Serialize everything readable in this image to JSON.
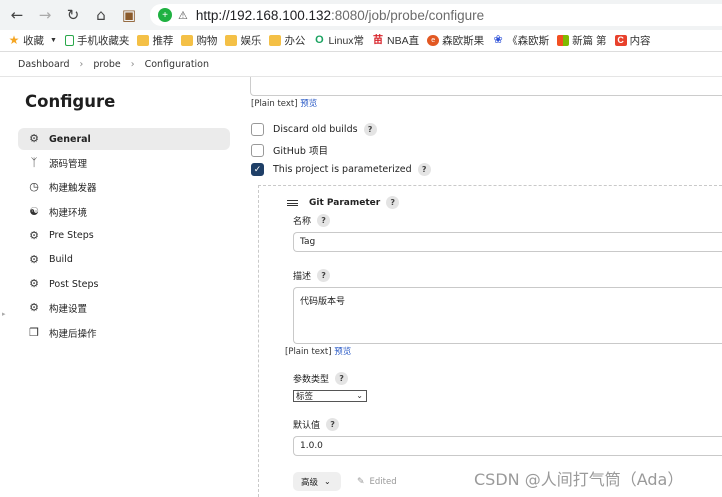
{
  "browser": {
    "url_host": "http://192.168.100.132",
    "url_path": ":8080/job/probe/configure",
    "bookmarks": [
      {
        "label": "收藏",
        "icon": "star-icon",
        "color": "#f5a623"
      },
      {
        "label": "手机收藏夹",
        "icon": "phone-icon",
        "color": "#2aa84a"
      },
      {
        "label": "推荐",
        "icon": "folder-icon",
        "color": "#f4c046"
      },
      {
        "label": "购物",
        "icon": "folder-icon",
        "color": "#f4c046"
      },
      {
        "label": "娱乐",
        "icon": "folder-icon",
        "color": "#f4c046"
      },
      {
        "label": "办公",
        "icon": "folder-icon",
        "color": "#f4c046"
      },
      {
        "label": "Linux常",
        "icon": "search-icon",
        "color": "#1aa260"
      },
      {
        "label": "NBA直",
        "icon": "nba-icon",
        "color": "#d8232a"
      },
      {
        "label": "森欧斯果",
        "icon": "cn-icon",
        "color": "#e25822"
      },
      {
        "label": "《森欧斯",
        "icon": "paw-icon",
        "color": "#2b4fd8"
      },
      {
        "label": "新篇 第",
        "icon": "windows-icon",
        "color": "#0078d4"
      },
      {
        "label": "内容",
        "icon": "c-icon",
        "color": "#e8412c"
      }
    ]
  },
  "breadcrumb": [
    "Dashboard",
    "probe",
    "Configuration"
  ],
  "sidebar": {
    "title": "Configure",
    "items": [
      {
        "label": "General",
        "icon": "gear-icon",
        "active": true
      },
      {
        "label": "源码管理",
        "icon": "branch-icon",
        "active": false
      },
      {
        "label": "构建触发器",
        "icon": "clock-icon",
        "active": false
      },
      {
        "label": "构建环境",
        "icon": "globe-icon",
        "active": false
      },
      {
        "label": "Pre Steps",
        "icon": "gear-icon",
        "active": false
      },
      {
        "label": "Build",
        "icon": "gear-icon",
        "active": false
      },
      {
        "label": "Post Steps",
        "icon": "gear-icon",
        "active": false
      },
      {
        "label": "构建设置",
        "icon": "gear-icon",
        "active": false
      },
      {
        "label": "构建后操作",
        "icon": "cube-icon",
        "active": false
      }
    ]
  },
  "main": {
    "plain_text_label": "[Plain text]",
    "preview_link": "预览",
    "checkboxes": [
      {
        "label": "Discard old builds",
        "checked": false,
        "help": true
      },
      {
        "label": "GitHub 项目",
        "checked": false,
        "help": false
      },
      {
        "label": "This project is parameterized",
        "checked": true,
        "help": true
      }
    ],
    "param": {
      "title": "Git Parameter",
      "name_label": "名称",
      "name_value": "Tag",
      "desc_label": "描述",
      "desc_value": "代码版本号",
      "plain_text_label": "[Plain text]",
      "preview_link": "预览",
      "type_label": "参数类型",
      "type_value": "标签",
      "default_label": "默认值",
      "default_value": "1.0.0",
      "advanced_label": "高级",
      "edited_label": "Edited"
    }
  },
  "watermark": "CSDN @人间打气筒（Ada）"
}
